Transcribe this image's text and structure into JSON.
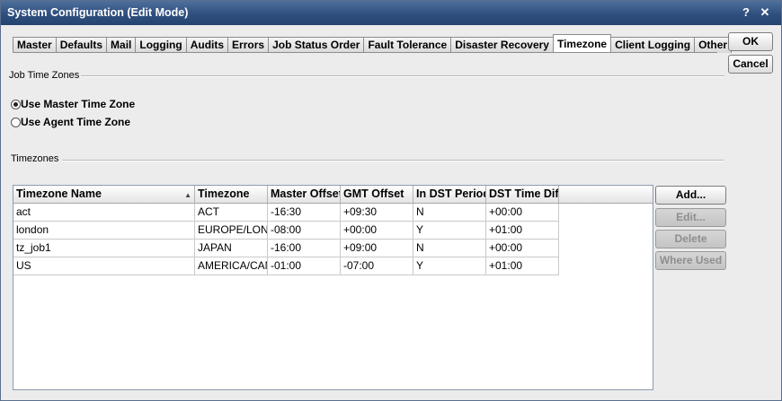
{
  "window": {
    "title": "System Configuration (Edit Mode)",
    "help_label": "?",
    "close_label": "✕"
  },
  "tabs": [
    {
      "label": "Master"
    },
    {
      "label": "Defaults"
    },
    {
      "label": "Mail"
    },
    {
      "label": "Logging"
    },
    {
      "label": "Audits"
    },
    {
      "label": "Errors"
    },
    {
      "label": "Job Status Order"
    },
    {
      "label": "Fault Tolerance"
    },
    {
      "label": "Disaster Recovery"
    },
    {
      "label": "Timezone",
      "active": true
    },
    {
      "label": "Client Logging"
    },
    {
      "label": "Other"
    }
  ],
  "dialog_buttons": {
    "ok": "OK",
    "cancel": "Cancel"
  },
  "job_time_zones": {
    "label": "Job Time Zones",
    "options": [
      {
        "label": "Use Master Time Zone",
        "checked": true
      },
      {
        "label": "Use Agent Time Zone",
        "checked": false
      }
    ]
  },
  "timezones": {
    "label": "Timezones",
    "columns": [
      "Timezone Name",
      "Timezone",
      "Master Offset",
      "GMT Offset",
      "In DST Period",
      "DST Time Diff"
    ],
    "rows": [
      [
        "act",
        "ACT",
        "-16:30",
        "+09:30",
        "N",
        "+00:00"
      ],
      [
        "london",
        "EUROPE/LONDON",
        "-08:00",
        "+00:00",
        "Y",
        "+01:00"
      ],
      [
        "tz_job1",
        "JAPAN",
        "-16:00",
        "+09:00",
        "N",
        "+00:00"
      ],
      [
        "US",
        "AMERICA/CANADA",
        "-01:00",
        "-07:00",
        "Y",
        "+01:00"
      ]
    ]
  },
  "table_buttons": {
    "add": "Add...",
    "edit": "Edit...",
    "delete": "Delete",
    "where_used": "Where Used"
  }
}
